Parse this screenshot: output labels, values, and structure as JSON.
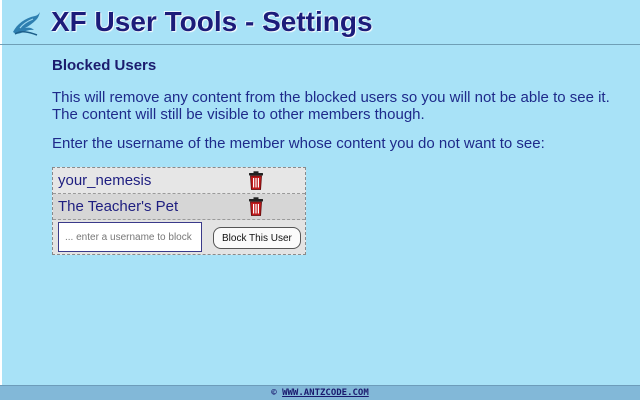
{
  "header": {
    "title": "XF User Tools - Settings",
    "logo_icon": "dolphin-icon"
  },
  "blocked_section": {
    "title": "Blocked Users",
    "description": "This will remove any content from the blocked users so you will not be able to see it. The content will still be visible to other members though.",
    "prompt": "Enter the username of the member whose content you do not want to see:",
    "users": [
      {
        "name": "your_nemesis",
        "remove_icon": "trash-icon"
      },
      {
        "name": "The Teacher's Pet",
        "remove_icon": "trash-icon"
      }
    ],
    "input": {
      "value": "",
      "placeholder": "... enter a username to block"
    },
    "block_button_label": "Block This User"
  },
  "footer": {
    "copyright_symbol": "©",
    "link_text": "WWW.ANTZCODE.COM"
  },
  "colors": {
    "background": "#a8e2f7",
    "title_text": "#1c1c7a",
    "footer_bg": "#82b8d8",
    "trash_red": "#c0191b"
  }
}
